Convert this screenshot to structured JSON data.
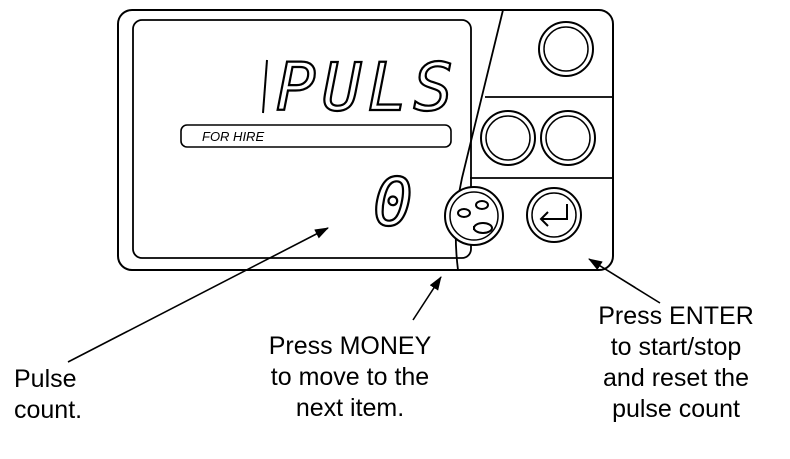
{
  "display": {
    "mode_text": "PULS",
    "tariff_label": "FOR HIRE",
    "count_value": "0"
  },
  "buttons": {
    "money_icon": "coins-icon",
    "enter_icon": "enter-arrow-icon"
  },
  "captions": {
    "pulse": [
      "Pulse",
      "count."
    ],
    "money": [
      "Press MONEY",
      "to move to the",
      "next item."
    ],
    "enter": [
      "Press ENTER",
      "to start/stop",
      "and reset the",
      "pulse count"
    ]
  }
}
